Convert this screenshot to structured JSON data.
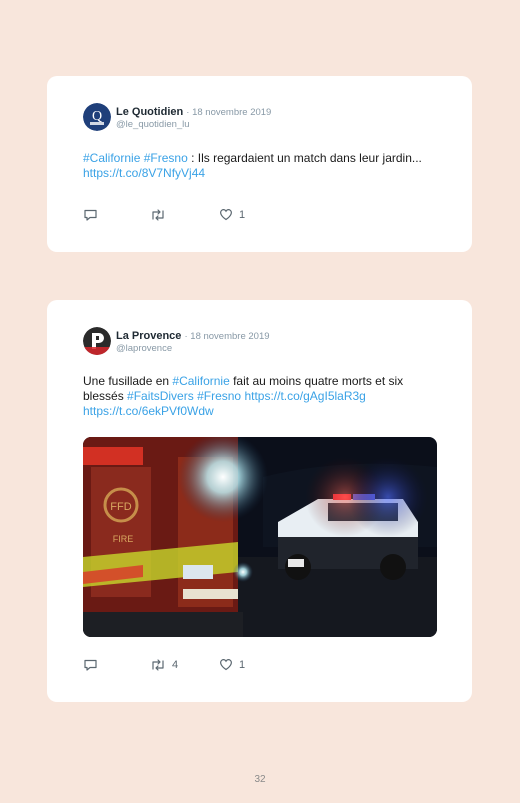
{
  "tweets": [
    {
      "name": "Le Quotidien",
      "date": "· 18 novembre 2019",
      "handle": "@le_quotidien_lu",
      "avatar_icon": "le-quotidien-logo",
      "text": {
        "tag1": "#Californie",
        "tag2": "#Fresno",
        "body": " : Ils regardaient un match dans leur jardin... ",
        "link": "https://t.co/8V7NfyVj44"
      },
      "actions": {
        "reply_count": "",
        "retweet_count": "",
        "like_count": "1"
      }
    },
    {
      "name": "La Provence",
      "date": "· 18 novembre 2019",
      "handle": "@laprovence",
      "avatar_icon": "la-provence-logo",
      "text": {
        "pre": "Une fusillade en ",
        "tag1": "#Californie",
        "body": " fait au moins quatre morts et six blessés ",
        "tag2": "#FaitsDivers",
        "tag3": "#Fresno",
        "link1": "https://t.co/gAgI5laR3g",
        "link2": "https://t.co/6ekPVf0Wdw"
      },
      "photo": {
        "description_icon": "fire-truck-police-car-night-photo"
      },
      "actions": {
        "reply_count": "",
        "retweet_count": "4",
        "like_count": "1"
      }
    }
  ],
  "page_number": "32",
  "colors": {
    "background": "#f8e6dc",
    "link": "#3aa2e6",
    "card": "#ffffff"
  }
}
